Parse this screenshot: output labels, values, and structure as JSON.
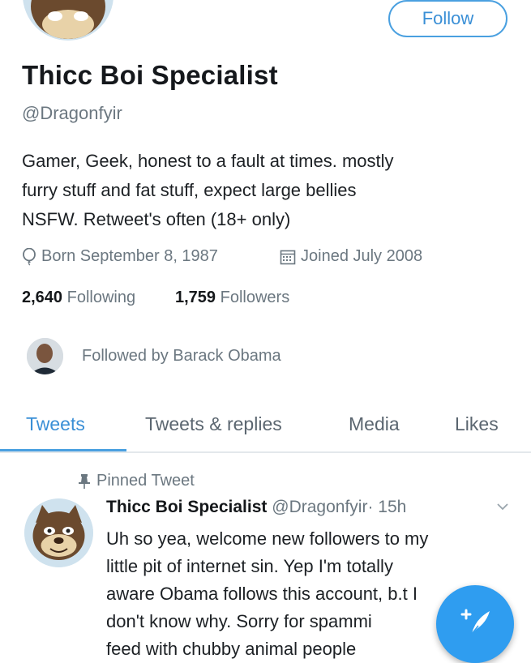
{
  "profile": {
    "display_name": "Thicc Boi Specialist",
    "handle": "@Dragonfyir",
    "follow_label": "Follow",
    "bio_lines": [
      "Gamer, Geek, honest to a fault at times. mostly",
      "furry stuff and fat stuff, expect large bellies",
      "NSFW. Retweet's often (18+ only)"
    ],
    "born": "Born September 8, 1987",
    "joined": "Joined July 2008",
    "following_count": "2,640",
    "following_label": "Following",
    "followers_count": "1,759",
    "followers_label": "Followers",
    "followed_by": "Followed by Barack Obama"
  },
  "tabs": [
    {
      "label": "Tweets",
      "active": true
    },
    {
      "label": "Tweets & replies",
      "active": false
    },
    {
      "label": "Media",
      "active": false
    },
    {
      "label": "Likes",
      "active": false
    }
  ],
  "pinned_tweet": {
    "pinned_label": "Pinned Tweet",
    "author_name": "Thicc Boi Specialist",
    "author_handle": "@Dragonfyir",
    "time": "· 15h",
    "text_lines": [
      "Uh so yea, welcome new followers to my",
      "little pit of internet sin. Yep I'm totally",
      "aware Obama follows this account, b.t I",
      "don't know why. Sorry for spammi",
      "feed with chubby animal people"
    ]
  },
  "colors": {
    "accent": "#3a8fd6",
    "fab": "#2f9df0",
    "secondary_text": "#6b7780"
  },
  "icons": {
    "born": "balloon-icon",
    "joined": "calendar-icon",
    "pin": "pin-icon",
    "chevron": "chevron-down-icon",
    "compose": "compose-tweet-icon"
  }
}
